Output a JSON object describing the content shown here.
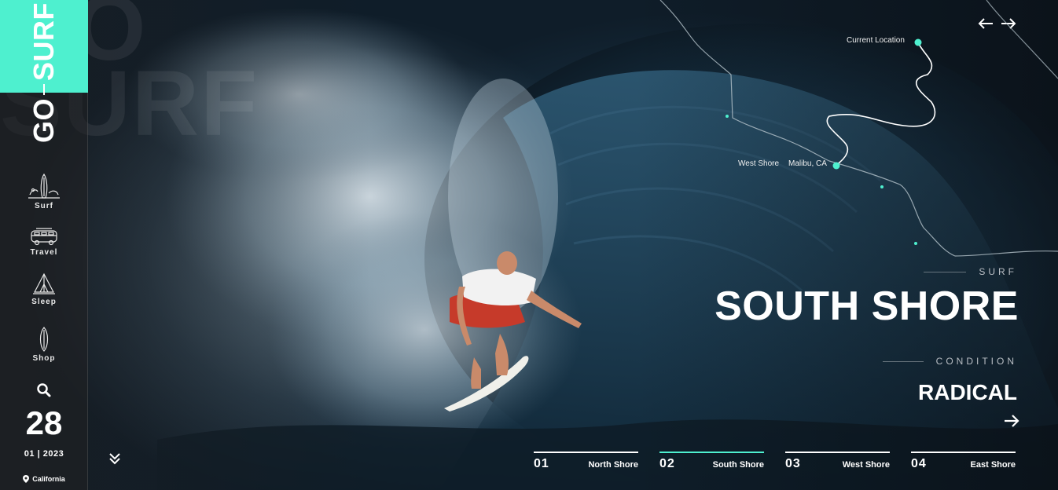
{
  "brand": {
    "logo_word_1": "GO",
    "logo_word_2": "SURF",
    "ghost_line_1": "GO",
    "ghost_line_2": "SURF",
    "accent_color": "#4ef0cf"
  },
  "sidebar": {
    "items": [
      {
        "label": "Surf",
        "icon": "surf-icon"
      },
      {
        "label": "Travel",
        "icon": "van-icon"
      },
      {
        "label": "Sleep",
        "icon": "tent-icon"
      },
      {
        "label": "Shop",
        "icon": "surfboard-icon"
      }
    ],
    "search_icon": "search-icon",
    "date_day": "28",
    "date_month_year": "01 | 2023",
    "location": "California",
    "location_icon": "pin-icon"
  },
  "map": {
    "current_location_label": "Current Location",
    "west_shore_label": "West Shore",
    "malibu_label": "Malibu, CA"
  },
  "header": {
    "prev_icon": "arrow-left-icon",
    "next_icon": "arrow-right-icon"
  },
  "main": {
    "category": "SURF",
    "title": "SOUTH SHORE",
    "condition_label": "CONDITION",
    "condition_value": "RADICAL",
    "go_icon": "arrow-right-icon"
  },
  "tabs": [
    {
      "num": "01",
      "name": "North Shore",
      "active": false
    },
    {
      "num": "02",
      "name": "South Shore",
      "active": true
    },
    {
      "num": "03",
      "name": "West Shore",
      "active": false
    },
    {
      "num": "04",
      "name": "East Shore",
      "active": false
    }
  ],
  "scroll_icon": "double-chevron-down-icon"
}
